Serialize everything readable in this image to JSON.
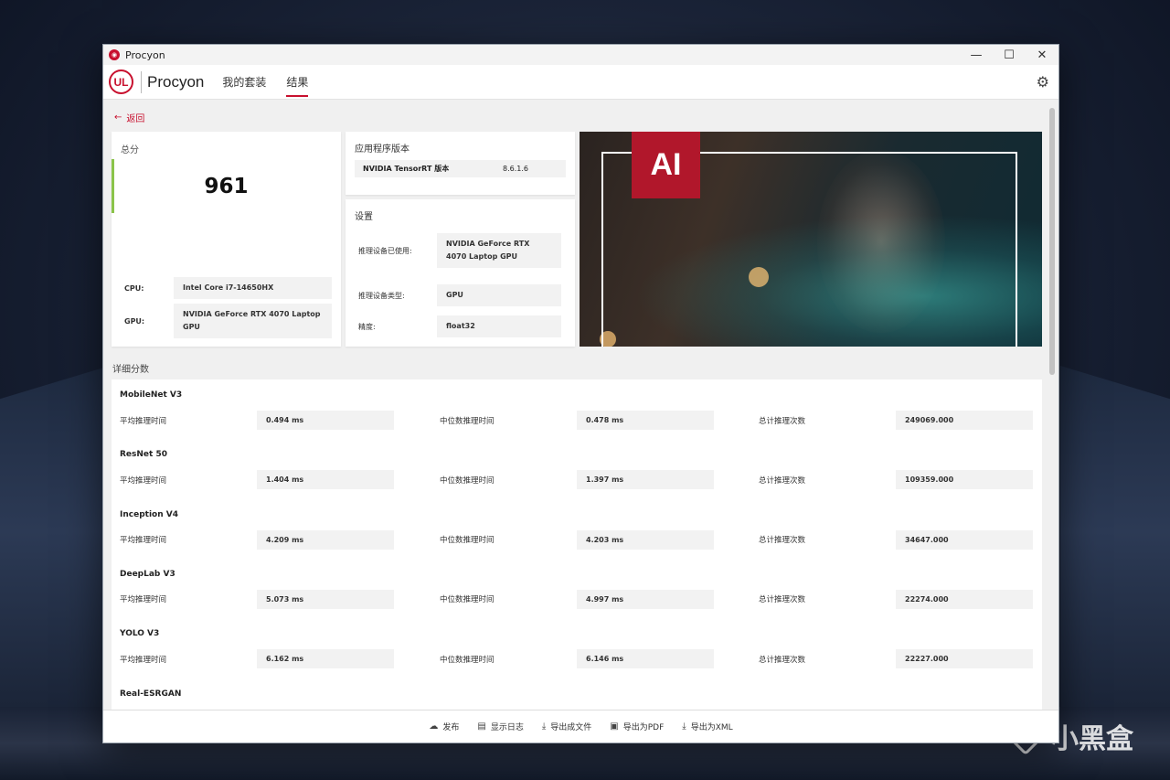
{
  "window": {
    "title": "Procyon"
  },
  "app": {
    "logo_text": "UL",
    "brand": "Procyon",
    "tabs": [
      {
        "label": "我的套装"
      },
      {
        "label": "结果"
      }
    ]
  },
  "back_label": "返回",
  "score": {
    "title": "总分",
    "value": "961",
    "cpu_label": "CPU:",
    "cpu_value": "Intel Core i7-14650HX",
    "gpu_label": "GPU:",
    "gpu_value": "NVIDIA GeForce RTX 4070 Laptop GPU",
    "bar_color": "#8bc34a"
  },
  "version": {
    "title": "应用程序版本",
    "key": "NVIDIA TensorRT 版本",
    "value": "8.6.1.6"
  },
  "settings": {
    "title": "设置",
    "rows": [
      {
        "label": "推理设备已使用:",
        "value": "NVIDIA GeForce RTX 4070 Laptop GPU"
      },
      {
        "label": "推理设备类型:",
        "value": "GPU"
      },
      {
        "label": "精度:",
        "value": "float32"
      }
    ]
  },
  "hero": {
    "logo_text": "AI"
  },
  "details": {
    "title": "详细分数",
    "metric_labels": {
      "avg": "平均推理时间",
      "median": "中位数推理时间",
      "total": "总计推理次数"
    },
    "models": [
      {
        "name": "MobileNet V3",
        "avg": "0.494 ms",
        "median": "0.478 ms",
        "total": "249069.000"
      },
      {
        "name": "ResNet 50",
        "avg": "1.404 ms",
        "median": "1.397 ms",
        "total": "109359.000"
      },
      {
        "name": "Inception V4",
        "avg": "4.209 ms",
        "median": "4.203 ms",
        "total": "34647.000"
      },
      {
        "name": "DeepLab V3",
        "avg": "5.073 ms",
        "median": "4.997 ms",
        "total": "22274.000"
      },
      {
        "name": "YOLO V3",
        "avg": "6.162 ms",
        "median": "6.146 ms",
        "total": "22227.000"
      },
      {
        "name": "Real-ESRGAN"
      }
    ]
  },
  "footer": {
    "buttons": [
      {
        "label": "发布",
        "icon": "cloud-upload-icon"
      },
      {
        "label": "显示日志",
        "icon": "document-icon"
      },
      {
        "label": "导出成文件",
        "icon": "download-icon"
      },
      {
        "label": "导出为PDF",
        "icon": "pdf-icon"
      },
      {
        "label": "导出为XML",
        "icon": "download-icon"
      }
    ]
  },
  "watermark": {
    "text": "小黑盒"
  },
  "colors": {
    "accent": "#c8102e",
    "score_bar": "#8bc34a",
    "hero_ai_bg": "#b1172b"
  }
}
